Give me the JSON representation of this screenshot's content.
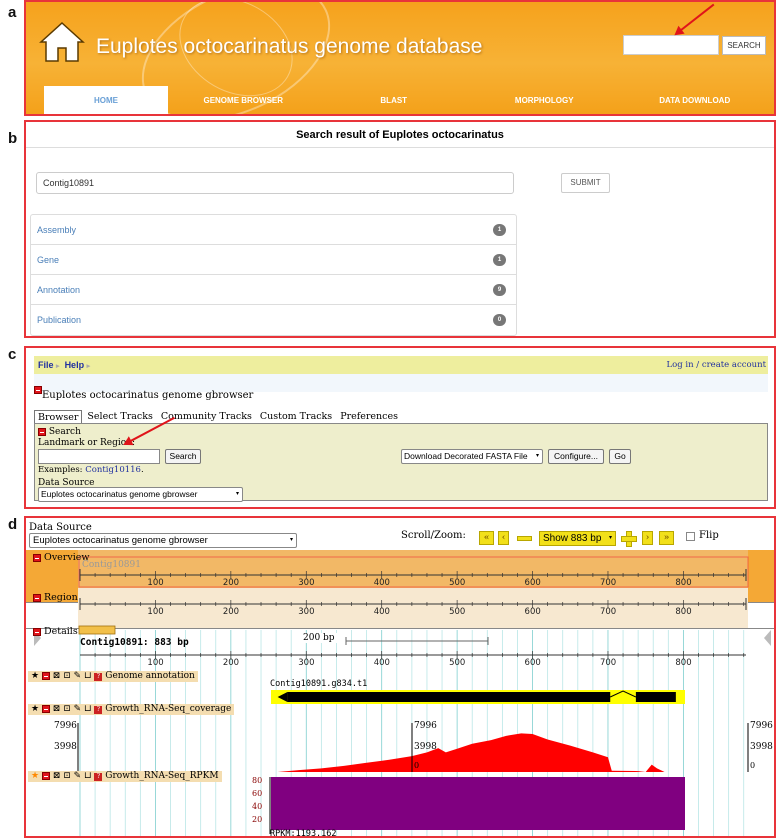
{
  "panel_labels": {
    "a": "a",
    "b": "b",
    "c": "c",
    "d": "d"
  },
  "site": {
    "title": "Euplotes octocarinatus genome database",
    "search_button": "SEARCH",
    "nav": [
      {
        "label": "HOME",
        "active": true
      },
      {
        "label": "GENOME BROWSER"
      },
      {
        "label": "BLAST"
      },
      {
        "label": "MORPHOLOGY"
      },
      {
        "label": "DATA DOWNLOAD"
      }
    ]
  },
  "results": {
    "heading": "Search result of Euplotes octocarinatus",
    "query": "Contig10891",
    "submit": "SUBMIT",
    "items": [
      {
        "label": "Assembly",
        "count": "1"
      },
      {
        "label": "Gene",
        "count": "1"
      },
      {
        "label": "Annotation",
        "count": "9"
      },
      {
        "label": "Publication",
        "count": "0"
      }
    ]
  },
  "gbrowse": {
    "menu_file": "File",
    "menu_help": "Help",
    "login": "Log in / create account",
    "title": "Euplotes octocarinatus genome gbrowser",
    "tabs": [
      "Browser",
      "Select Tracks",
      "Community Tracks",
      "Custom Tracks",
      "Preferences"
    ],
    "search_title": "Search",
    "landmark_label": "Landmark or Region:",
    "search_button": "Search",
    "examples_label": "Examples:",
    "example_link": "Contig10116",
    "example_end": ".",
    "download_select": "Download Decorated FASTA File",
    "configure_button": "Configure...",
    "go_button": "Go",
    "data_source_label": "Data Source",
    "data_source_value": "Euplotes octocarinatus genome gbrowser"
  },
  "viewer": {
    "data_source_label": "Data Source",
    "data_source_value": "Euplotes octocarinatus genome gbrowser",
    "scroll_zoom": "Scroll/Zoom:",
    "show_select": "Show 883 bp",
    "flip": "Flip",
    "overview_label": "Overview",
    "region_label": "Region",
    "details_label": "Details",
    "contig": "Contig10891",
    "details_title": "Contig10891: 883 bp",
    "scale_label": "200 bp",
    "ticks": [
      "100",
      "200",
      "300",
      "400",
      "500",
      "600",
      "700",
      "800"
    ],
    "tracks": {
      "annotation": "Genome annotation",
      "coverage": "Growth_RNA-Seq_coverage",
      "rpkm": "Growth_RNA-Seq_RPKM"
    },
    "gene_label": "Contig10891.g834.t1",
    "cov_max": "7996",
    "cov_mid": "3998",
    "cov_zero": "0",
    "rpkm_ticks": [
      "80",
      "60",
      "40",
      "20"
    ],
    "rpkm_value": "RPKM:1193.162",
    "colors": {
      "coverage": "#ff0000",
      "rpkm": "#800080",
      "gene": "#000000",
      "gene_bg": "#ffff00"
    }
  }
}
